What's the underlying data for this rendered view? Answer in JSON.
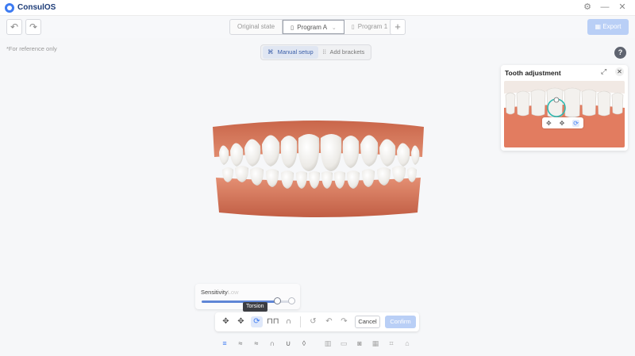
{
  "app": {
    "title": "ConsulOS"
  },
  "window_controls": {
    "settings_icon": "⚙",
    "minimize_icon": "—",
    "close_icon": "✕"
  },
  "toolbar": {
    "undo_icon": "↶",
    "redo_icon": "↷",
    "tabs": [
      {
        "label": "Original state",
        "icon": "",
        "dropdown": ""
      },
      {
        "label": "Program A",
        "icon": "▯",
        "dropdown": "⌄"
      },
      {
        "label": "Program 1",
        "icon": "▯",
        "dropdown": "⌄"
      }
    ],
    "add_tab": "+",
    "export_label": "Export",
    "export_icon": "▦"
  },
  "canvas": {
    "reference_note": "*For reference only",
    "modes": [
      {
        "label": "Manual setup",
        "icon": "⌘"
      },
      {
        "label": "Add brackets",
        "icon": "⁞⁞"
      }
    ],
    "help_label": "?"
  },
  "tooth_adjustment": {
    "title": "Tooth adjustment",
    "expand_icon": "⤢",
    "close_icon": "✕",
    "tool_icons": [
      "✥",
      "✥",
      "⟳"
    ]
  },
  "sensitivity": {
    "label_main": "Sensitivity",
    "label_faded": "Low",
    "level": 0.82
  },
  "tooltip": "Torsion",
  "adjust_tools": {
    "icons": [
      "✥",
      "✥",
      "⟳",
      "⊓⊓",
      "∩"
    ],
    "reset_icon": "↺",
    "undo_icon": "↶",
    "redo_icon": "↷",
    "cancel_label": "Cancel",
    "confirm_label": "Confirm"
  },
  "view_tools": {
    "icons": [
      "≡",
      "≈",
      "≈",
      "∩",
      "∪",
      "◊",
      "▥",
      "▭",
      "◙",
      "▦",
      "⌗",
      "⌂"
    ]
  }
}
